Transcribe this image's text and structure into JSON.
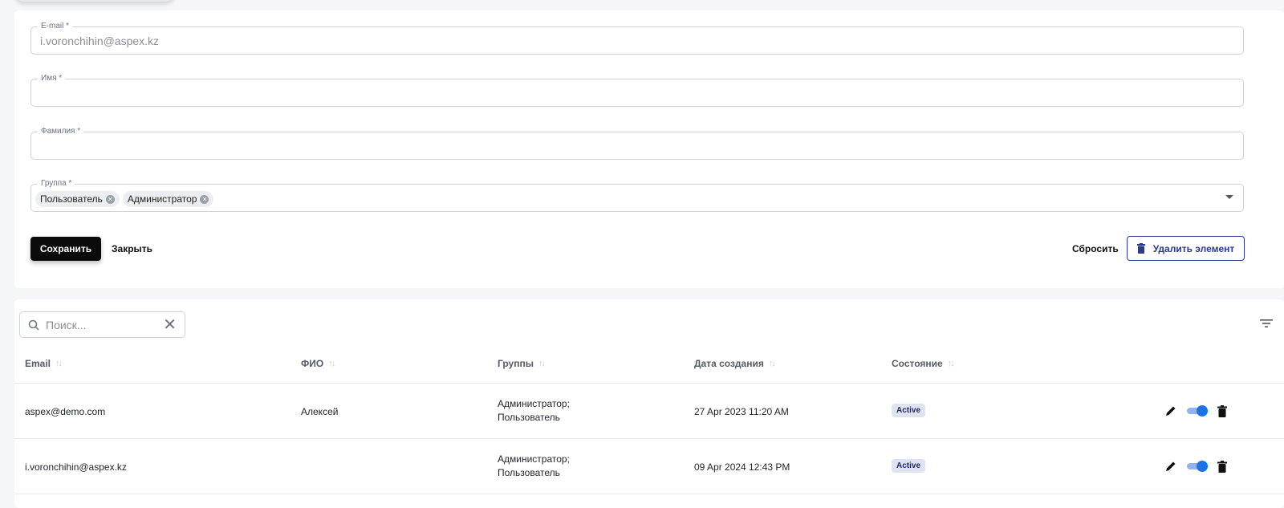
{
  "form": {
    "email": {
      "label": "E-mail *",
      "value": "i.voronchihin@aspex.kz"
    },
    "first_name": {
      "label": "Имя *",
      "value": ""
    },
    "last_name": {
      "label": "Фамилия *",
      "value": ""
    },
    "group": {
      "label": "Группа *",
      "chips": [
        "Пользователь",
        "Администратор"
      ]
    },
    "save_label": "Сохранить",
    "close_label": "Закрыть",
    "reset_label": "Сбросить",
    "delete_label": "Удалить элемент"
  },
  "table": {
    "search_placeholder": "Поиск...",
    "columns": [
      "Email",
      "ФИО",
      "Группы",
      "Дата создания",
      "Состояние"
    ],
    "rows": [
      {
        "email": "aspex@demo.com",
        "name": "Алексей",
        "groups": [
          "Администратор;",
          "Пользователь"
        ],
        "created": "27 Apr 2023 11:20 AM",
        "status": "Active"
      },
      {
        "email": "i.voronchihin@aspex.kz",
        "name": "",
        "groups": [
          "Администратор;",
          "Пользователь"
        ],
        "created": "09 Apr 2024 12:43 PM",
        "status": "Active"
      }
    ]
  },
  "colors": {
    "accent": "#1a73e8",
    "delete_button": "#2b3a8c",
    "badge_bg": "#dfe2f0"
  },
  "icons": [
    "search-icon",
    "clear-icon",
    "filter-icon",
    "sort-icon",
    "edit-icon",
    "toggle-switch",
    "trash-icon",
    "chevron-down-icon",
    "chip-remove-icon"
  ]
}
